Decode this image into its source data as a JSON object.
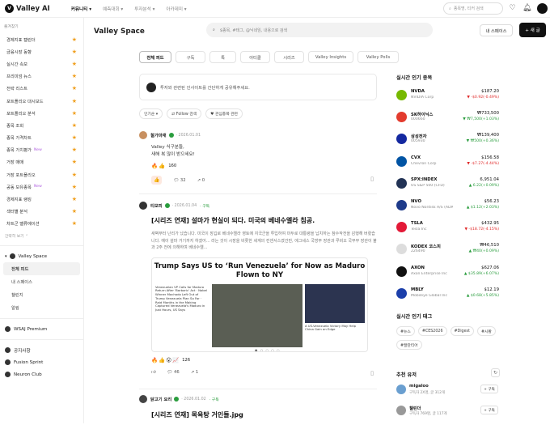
{
  "app": {
    "name": "Valley AI",
    "logo_mark": "V"
  },
  "topnav": [
    {
      "label": "커뮤니티 ▾",
      "active": true
    },
    {
      "label": "예측대회 ▾",
      "active": false
    },
    {
      "label": "투자분석 ▾",
      "active": false
    },
    {
      "label": "아카데미 ▾",
      "active": false
    }
  ],
  "header_search": {
    "placeholder": "종목명, 티커 검색"
  },
  "sidebar": {
    "favorites_header": "즐겨찾기",
    "items": [
      {
        "label": "경제지표 캘린더"
      },
      {
        "label": "금융시장 동향"
      },
      {
        "label": "실시간 속보"
      },
      {
        "label": "프리미엄 뉴스"
      },
      {
        "label": "전략 리스트"
      },
      {
        "label": "포트폴리오 대시보드"
      },
      {
        "label": "포트폴리오 분석"
      },
      {
        "label": "종목 조회"
      },
      {
        "label": "종목 가격차트"
      },
      {
        "label": "종목 가치평가",
        "badge": "New"
      },
      {
        "label": "거장 매매"
      },
      {
        "label": "거장 포트폴리오"
      },
      {
        "label": "공동 보유종목",
        "badge": "New"
      },
      {
        "label": "경제지표 랭킹"
      },
      {
        "label": "섹터별 분석"
      },
      {
        "label": "차트군 밸류에이션"
      }
    ],
    "more": "간략히 보기 ⌃",
    "space_section": {
      "label": "Valley Space",
      "subs": [
        {
          "label": "전체 피드",
          "active": true
        },
        {
          "label": "내 스페이스"
        },
        {
          "label": "챌린지"
        },
        {
          "label": "알림"
        }
      ]
    },
    "bottom": [
      {
        "label": "WSAJ Premium"
      },
      {
        "label": "공지사항"
      },
      {
        "label": "Fusion Sprint"
      },
      {
        "label": "Neuron Club"
      }
    ]
  },
  "main": {
    "title": "Valley Space",
    "search_placeholder": "$종목, #태그, @닉네임, 내용으로 검색",
    "myspace_button": "내 스페이스",
    "new_button": "+ 새 글",
    "tabs": [
      {
        "label": "전체 피드"
      },
      {
        "label": "구독"
      },
      {
        "label": "톡"
      },
      {
        "label": "아티클"
      },
      {
        "label": "시리즈"
      },
      {
        "label": "Valley Insights"
      },
      {
        "label": "Valley Polls"
      }
    ],
    "composer_placeholder": "투자와 관련된 인사이트를 간단하게 공유해주세요.",
    "filters": [
      "인기순 ▾",
      "⇄ Follow 검색",
      "♥ 관심종목 관련"
    ],
    "posts": [
      {
        "name": "철가마재",
        "date": "· 2026.01.01",
        "follow": "",
        "lines": [
          "Valley 식구분들,",
          "새해 복 많이 받으세요!"
        ],
        "react_count": "160",
        "comments": "32",
        "shares": "0"
      },
      {
        "name": "티모피",
        "date": "· 2026.01.04",
        "follow": "· 구독",
        "title": "[시리즈 연재] 설마가 현실이 되다. 미국의 베네수엘라 침공.",
        "body": "새벽부터 난리가 났습니다. 미국이 장깁로 베네수엘라 영토에 지국군을 투입하여 마두로 대통령을 납치하는 참수작전을 감행해 버렸습니다. 예이 설마 거기까지 하겠어... 라는 것이 시장을 비롯한 세계의 컨센서스였건만, 에그세스 국방부 장관과 루비오 국무부 장관이 불과 2주 전에 의해하며 베네수엘...",
        "embed_title": "Trump Says US to ‘Run Venezuela’ for Now as Maduro Flown to NY",
        "embed_left": "Venezuelan VP Calls for Maduro Return After 'Barbaric' Act  ·  Nobel Winner Machado Left Out of Trump Venezuela Plan So Far  ·  Raid Months in the Making Captured Venezuela's Maduro in Just Hours, US Says",
        "embed_right": "A US-Venezuela Victory May Help China Gain an Edge",
        "react_count": "126",
        "comments": "46",
        "shares": "1"
      },
      {
        "name": "닭고기 요리",
        "date": "· 2026.01.02",
        "follow": "· 구독",
        "title": "[시리즈 연재] 목욕탕 거인들.jpg"
      }
    ]
  },
  "right": {
    "stocks_title": "실시간 인기 종목",
    "stocks": [
      {
        "ticker": "NVDA",
        "name": "NVIDIA Corp",
        "price": "$187.20",
        "change": "▼ -$0.92(-0.49%)",
        "dir": "down",
        "color": "#76b900"
      },
      {
        "ticker": "SK하이닉스",
        "name": "000660",
        "price": "₩733,500",
        "change": "▼ ₩7,500(+1.03%)",
        "dir": "up",
        "color": "#e33b2e"
      },
      {
        "ticker": "삼성전자",
        "name": "005930",
        "price": "₩139,400",
        "change": "▼ ₩500(+0.36%)",
        "dir": "up",
        "color": "#1428a0"
      },
      {
        "ticker": "CVX",
        "name": "Chevron Corp",
        "price": "$156.58",
        "change": "▼ -$7.27(-4.44%)",
        "dir": "down",
        "color": "#0054a4"
      },
      {
        "ticker": "SPX:INDEX",
        "name": "US S&P 500 (CFD)",
        "price": "6,951.04",
        "change": "▲ 6.22(+0.09%)",
        "dir": "up",
        "color": "#223355"
      },
      {
        "ticker": "NVO",
        "name": "Novo Nordisk A/S (ADR)",
        "price": "$56.23",
        "change": "▲ $1.12(+2.03%)",
        "dir": "up",
        "color": "#1e3a8a"
      },
      {
        "ticker": "TSLA",
        "name": "Tesla Inc",
        "price": "$432.95",
        "change": "▼ -$18.72(-4.15%)",
        "dir": "down",
        "color": "#e31937"
      },
      {
        "ticker": "KODEX 코스피",
        "name": "226490",
        "price": "₩46,510",
        "change": "▲ ₩40(+0.09%)",
        "dir": "up",
        "color": "#dddddd"
      },
      {
        "ticker": "AXON",
        "name": "Axon Enterprise Inc",
        "price": "$627.06",
        "change": "▲ $35.89(+6.07%)",
        "dir": "up",
        "color": "#111111"
      },
      {
        "ticker": "MBLY",
        "name": "Mobileye Global Inc",
        "price": "$12.19",
        "change": "▲ $0.68(+5.85%)",
        "dir": "up",
        "color": "#1c3faa"
      }
    ],
    "tags_title": "실시간 인기 태그",
    "tags": [
      "#뉴스",
      "#CES2026",
      "#Digest",
      "#시황",
      "#팔란티어"
    ],
    "users_title": "추천 유저",
    "users": [
      {
        "name": "migaloo",
        "sub": "구독자 2X명, 글 312개",
        "button": "+ 구독"
      },
      {
        "name": "챌린더",
        "sub": "구독자 769명, 글 117개",
        "button": "+ 구독"
      }
    ]
  }
}
